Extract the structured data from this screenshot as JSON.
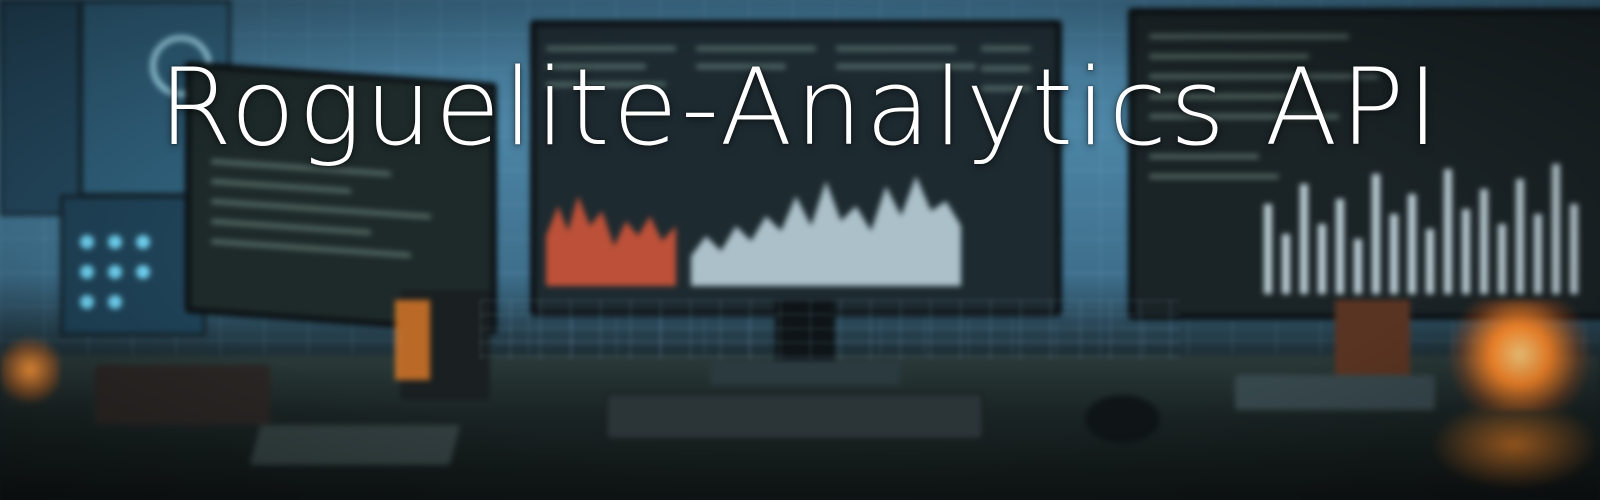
{
  "banner": {
    "title": "Roguelite-Analytics API"
  },
  "colors": {
    "title_text": "#ffffff",
    "accent_orange": "#ff8a2a",
    "accent_blue": "#4d86a6",
    "chart_red": "#d8573a",
    "chart_pale": "#cfe6f0"
  },
  "background": {
    "description_icon": "multi-monitor-desk-icon"
  }
}
